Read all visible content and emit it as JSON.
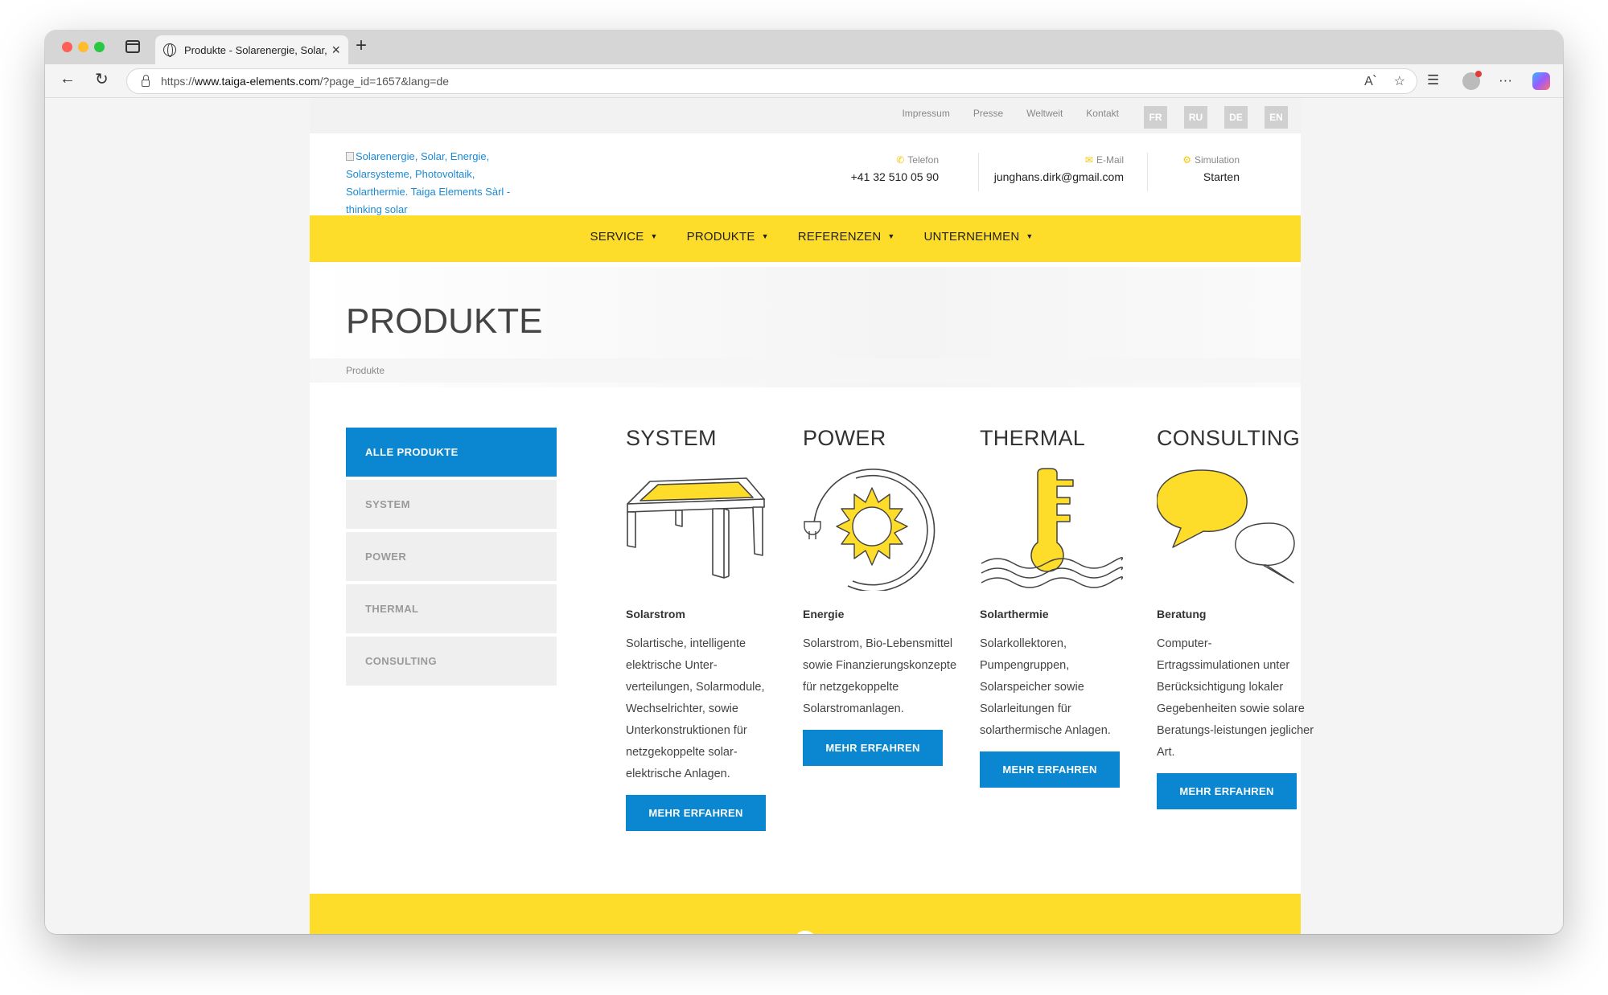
{
  "browser": {
    "tab_title": "Produkte - Solarenergie, Solar,",
    "url_prefix": "https://",
    "url_host": "www.taiga-elements.com",
    "url_path": "/?page_id=1657&lang=de"
  },
  "topbar": {
    "links": [
      "Impressum",
      "Presse",
      "Weltweit",
      "Kontakt"
    ],
    "languages": [
      "FR",
      "RU",
      "DE",
      "EN"
    ]
  },
  "header": {
    "logo_alt": "Solarenergie, Solar, Energie, Solarsysteme, Photovoltaik, Solarthermie. Taiga Elements Sàrl - thinking solar",
    "phone_label": "Telefon",
    "phone_value": "+41 32 510 05 90",
    "email_label": "E-Mail",
    "email_value": "junghans.dirk@gmail.com",
    "sim_label": "Simulation",
    "sim_value": "Starten"
  },
  "menu": [
    "SERVICE",
    "PRODUKTE",
    "REFERENZEN",
    "UNTERNEHMEN"
  ],
  "page": {
    "title": "PRODUKTE",
    "breadcrumb": "Produkte"
  },
  "sidebar": {
    "items": [
      "ALLE PRODUKTE",
      "SYSTEM",
      "POWER",
      "THERMAL",
      "CONSULTING"
    ],
    "active_index": 0
  },
  "products": [
    {
      "title": "SYSTEM",
      "icon": "solar-table-icon",
      "subtitle": "Solarstrom",
      "text": "Solartische, intelligente elektrische Unter-verteilungen, Solarmodule, Wechselrichter, sowie Unterkonstruktionen für netzgekoppelte solar-elektrische Anlagen.",
      "button": "MEHR ERFAHREN"
    },
    {
      "title": "POWER",
      "icon": "sun-plug-icon",
      "subtitle": "Energie",
      "text": "Solarstrom, Bio-Lebensmittel sowie Finanzierungskonzepte für netzgekoppelte Solarstromanlagen.",
      "button": "MEHR ERFAHREN"
    },
    {
      "title": "THERMAL",
      "icon": "thermometer-waves-icon",
      "subtitle": "Solarthermie",
      "text": "Solarkollektoren, Pumpengruppen, Solarspeicher sowie Solarleitungen für solarthermische Anlagen.",
      "button": "MEHR ERFAHREN"
    },
    {
      "title": "CONSULTING",
      "icon": "speech-bubbles-icon",
      "subtitle": "Beratung",
      "text": "Computer-Ertragssimulationen unter Berücksichtigung lokaler Gegebenheiten sowie solare Beratungs-leistungen jeglicher Art.",
      "button": "MEHR ERFAHREN"
    }
  ],
  "colors": {
    "brand_yellow": "#fedc2a",
    "brand_blue": "#0a87d0"
  }
}
